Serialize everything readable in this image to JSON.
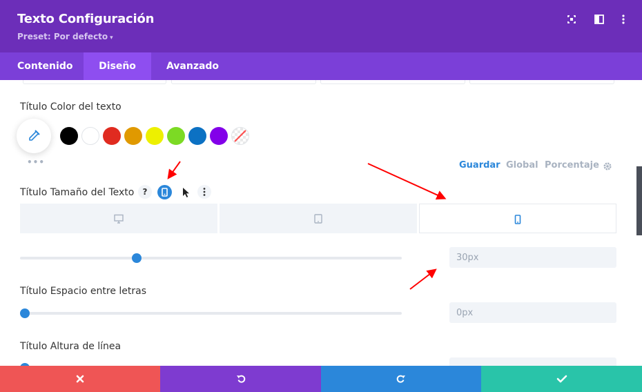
{
  "header": {
    "title": "Texto Configuración",
    "preset": "Preset: Por defecto",
    "preset_caret": "▾"
  },
  "tabs": [
    {
      "label": "Contenido"
    },
    {
      "label": "Diseño"
    },
    {
      "label": "Avanzado"
    }
  ],
  "text_color": {
    "label": "Título Color del texto",
    "swatches": [
      "#000000",
      "#ffffff",
      "#e02b20",
      "#e09900",
      "#edf000",
      "#7cda24",
      "#0c71c3",
      "#8300e9"
    ],
    "more": "•••"
  },
  "preset_tabs": [
    "Guardar",
    "Global",
    "Porcentaje"
  ],
  "font_size": {
    "label": "Título Tamaño del Texto",
    "help": "?",
    "value": "30px",
    "slider_fraction": 0.3
  },
  "letter_spacing": {
    "label": "Título Espacio entre letras",
    "value": "0px",
    "slider_fraction": 0.0
  },
  "line_height": {
    "label": "Título Altura de línea"
  },
  "colors": {
    "header": "#6c2eb9",
    "tabs": "#7b3fd8",
    "tab_active": "#8e4ef0",
    "accent": "#2b87da",
    "cancel": "#ef5555",
    "undo": "#7e3bd0",
    "redo": "#2b87da",
    "save": "#29c4a9",
    "annotation": "#ff0000"
  }
}
